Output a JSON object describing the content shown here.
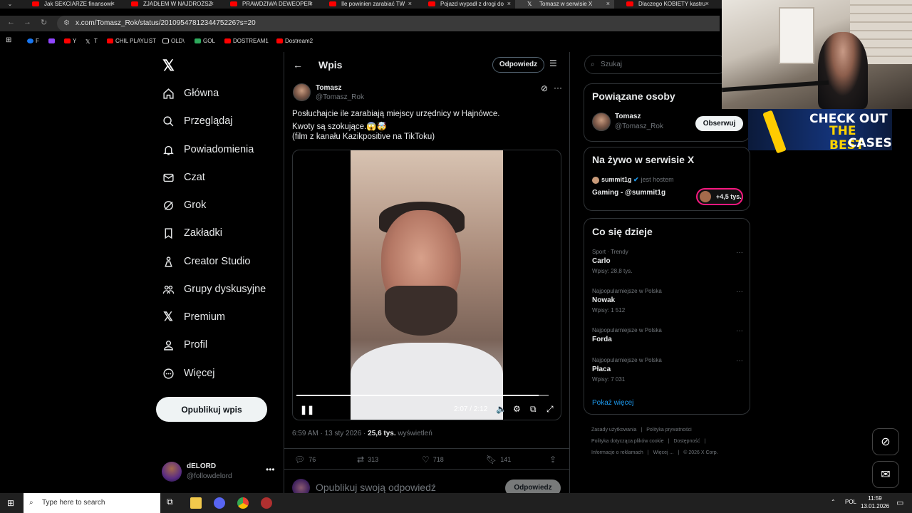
{
  "browser": {
    "tabs": [
      {
        "title": "Jak SEKCIARZE finansowi",
        "close": "×"
      },
      {
        "title": "ZJADŁEM W NAJDROŻSZ",
        "close": "×"
      },
      {
        "title": "PRAWDZIWA DEWEOPER",
        "close": "×"
      },
      {
        "title": "Ile powinien zarabiać TW",
        "close": "×"
      },
      {
        "title": "Pojazd wypadł z drogi do",
        "close": "×"
      },
      {
        "title": "Tomasz w serwisie X",
        "close": "×"
      },
      {
        "title": "Dlaczego KOBIETY kastru",
        "close": "×"
      }
    ],
    "url": "x.com/Tomasz_Rok/status/2010954781234475226?s=20",
    "bookmarks": [
      "F",
      "Y",
      "T",
      "CHIL PLAYLIST",
      "OLD\\",
      "GOL",
      "DOSTREAM1",
      "Dostream2"
    ]
  },
  "sidebar": {
    "items": [
      {
        "label": "Główna"
      },
      {
        "label": "Przeglądaj"
      },
      {
        "label": "Powiadomienia"
      },
      {
        "label": "Czat"
      },
      {
        "label": "Grok"
      },
      {
        "label": "Zakładki"
      },
      {
        "label": "Creator Studio"
      },
      {
        "label": "Grupy dyskusyjne"
      },
      {
        "label": "Premium"
      },
      {
        "label": "Profil"
      },
      {
        "label": "Więcej"
      }
    ],
    "post_button": "Opublikuj wpis",
    "account": {
      "name": "dELORD",
      "handle": "@followdelord"
    }
  },
  "post": {
    "header_title": "Wpis",
    "reply_button": "Odpowiedz",
    "author_name": "Tomasz",
    "author_handle": "@Tomasz_Rok",
    "text_lines": [
      "Posłuchajcie ile zarabiają miejscy urzędnicy w Hajnówce.",
      "Kwoty są szokujące.😱🤯",
      "(film z kanału Kazikpositive na TikToku)"
    ],
    "video": {
      "time": "2:07 / 2:12",
      "progress": 0.96
    },
    "timestamp": "6:59 AM · 13 sty 2026 · ",
    "views_count": "25,6 tys.",
    "views_label": " wyświetleń",
    "stats": {
      "replies": "76",
      "reposts": "313",
      "likes": "718",
      "bookmarks": "141"
    },
    "reply_placeholder": "Opublikuj swoją odpowiedź",
    "reply_submit": "Odpowiedz"
  },
  "right": {
    "search_placeholder": "Szukaj",
    "related": {
      "title": "Powiązane osoby",
      "name": "Tomasz",
      "handle": "@Tomasz_Rok",
      "follow": "Obserwuj"
    },
    "live": {
      "title": "Na żywo w serwisie X",
      "host": "summit1g",
      "host_suffix": "jest hostem",
      "stream": "Gaming - @summit1g",
      "count": "+4,5 tys."
    },
    "trends": {
      "title": "Co się dzieje",
      "items": [
        {
          "context": "Sport · Trendy",
          "name": "Carlo",
          "posts": "Wpisy: 28,8 tys."
        },
        {
          "context": "Najpopularniejsze w Polska",
          "name": "Nowak",
          "posts": "Wpisy: 1 512"
        },
        {
          "context": "Najpopularniejsze w Polska",
          "name": "Forda",
          "posts": ""
        },
        {
          "context": "Najpopularniejsze w Polska",
          "name": "Płaca",
          "posts": "Wpisy: 7 031"
        }
      ],
      "show_more": "Pokaż więcej"
    },
    "footer": [
      "Zasady użytkowania",
      "|",
      "Polityka prywatności",
      "|",
      "Polityka dotycząca plików cookie",
      "|",
      "Dostępność",
      "|",
      "Informacje o reklamach",
      "|",
      "Więcej ...",
      "|",
      "© 2026 X Corp."
    ]
  },
  "ad": {
    "line1": "CHECK",
    "line1b": "OUT",
    "line2": "THE BEST",
    "line3": "CASES"
  },
  "taskbar": {
    "search_placeholder": "Type here to search",
    "lang": "POL",
    "time": "11:59",
    "date": "13.01.2026"
  },
  "colors": {
    "accent": "#1d9bf0",
    "live_ring": "#f91880",
    "background": "#000000"
  }
}
